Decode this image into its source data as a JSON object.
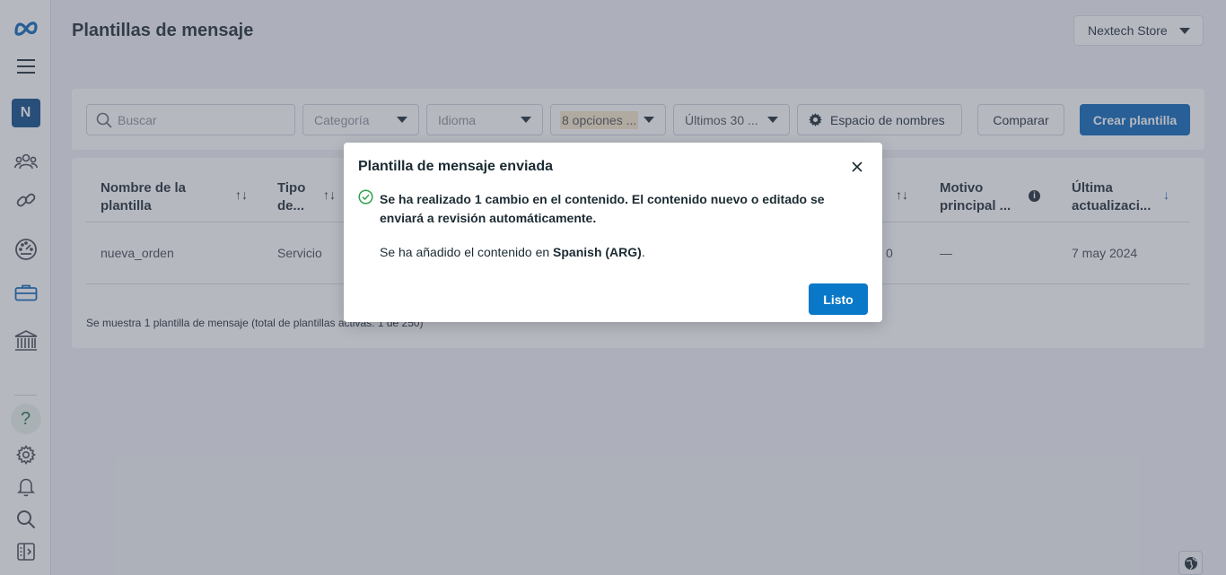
{
  "header": {
    "title": "Plantillas de mensaje",
    "account": "Nextech Store"
  },
  "sidebar": {
    "avatar_letter": "N",
    "help_glyph": "?",
    "items": [
      "meta-logo-icon",
      "menu-icon",
      "account-avatar",
      "people-icon",
      "link-icon",
      "dashboard-icon",
      "briefcase-icon",
      "bank-icon",
      "help-icon",
      "settings-icon",
      "bell-icon",
      "search-icon",
      "panel-icon"
    ]
  },
  "toolbar": {
    "search_placeholder": "Buscar",
    "category": "Categoría",
    "language": "Idioma",
    "options": "8 opciones ...",
    "date_range": "Últimos 30 ...",
    "namespace": "Espacio de nombres",
    "compare": "Comparar",
    "create": "Crear plantilla"
  },
  "table": {
    "columns": [
      {
        "l1": "Nombre de la",
        "l2": "plantilla"
      },
      {
        "l1": "Tipo",
        "l2": "de..."
      },
      {
        "l1": "Motivo",
        "l2": "principal ..."
      },
      {
        "l1": "Última",
        "l2": "actualizaci..."
      }
    ],
    "row": {
      "name": "nueva_orden",
      "type": "Servicio",
      "hidden_count": "0",
      "reason": "—",
      "updated": "7 may 2024"
    },
    "footer": "Se muestra 1 plantilla de mensaje (total de plantillas activas: 1 de 250)"
  },
  "modal": {
    "title": "Plantilla de mensaje enviada",
    "message_bold": "Se ha realizado 1 cambio en el contenido. El contenido nuevo o editado se enviará a revisión automáticamente.",
    "note_prefix": "Se ha añadido el contenido en ",
    "note_lang": "Spanish (ARG)",
    "note_suffix": ".",
    "done": "Listo"
  },
  "colors": {
    "primary": "#0a66b7",
    "modal_button": "#0a78c8",
    "avatar_bg": "#0a4a86",
    "success": "#31a24c"
  }
}
